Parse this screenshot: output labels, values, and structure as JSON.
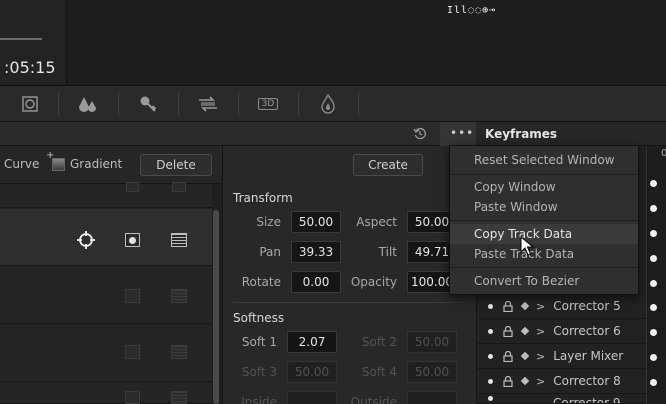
{
  "viewer": {
    "timecode": ":05:15",
    "status_icons": "Ill◌◌⊕⊸"
  },
  "toolbar": {
    "tools": [
      "window-icon",
      "qualifier-icon",
      "key-icon",
      "blur-icon",
      "3d-icon",
      "fx-icon"
    ],
    "label_3d": "3D"
  },
  "window_panel": {
    "curve_label": "Curve",
    "gradient_label": "Gradient",
    "delete_label": "Delete"
  },
  "transform_panel": {
    "create_label": "Create",
    "transform_title": "Transform",
    "fields": {
      "size_label": "Size",
      "size_value": "50.00",
      "aspect_label": "Aspect",
      "aspect_value": "50.00",
      "pan_label": "Pan",
      "pan_value": "39.33",
      "tilt_label": "Tilt",
      "tilt_value": "49.71",
      "rotate_label": "Rotate",
      "rotate_value": "0.00",
      "opacity_label": "Opacity",
      "opacity_value": "100.00"
    },
    "softness_title": "Softness",
    "softness": {
      "soft1_label": "Soft 1",
      "soft1_value": "2.07",
      "soft2_label": "Soft 2",
      "soft2_value": "50.00",
      "soft3_label": "Soft 3",
      "soft3_value": "50.00",
      "soft4_label": "Soft 4",
      "soft4_value": "50.00",
      "inside_label": "Inside",
      "outside_label": "Outside"
    }
  },
  "keyframes": {
    "title": "Keyframes",
    "time_zero": "0",
    "tracks": [
      "Corrector 5",
      "Corrector 6",
      "Layer Mixer",
      "Corrector 8",
      "Corrector 9"
    ]
  },
  "context_menu": {
    "items": [
      "Reset Selected Window",
      "Copy Window",
      "Paste Window",
      "Copy Track Data",
      "Paste Track Data",
      "Convert To Bezier"
    ]
  },
  "colors": {
    "background": "#1c1c1e",
    "menu_bg": "#2f2f31",
    "menu_hover": "#3b3b3d"
  }
}
